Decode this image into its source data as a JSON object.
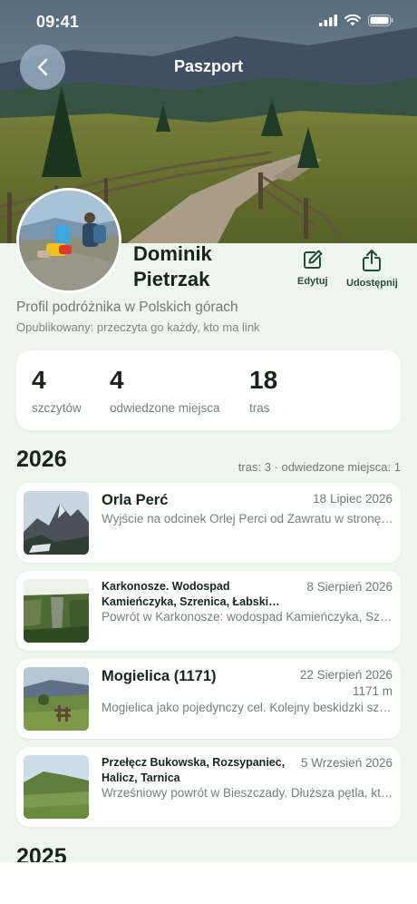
{
  "status_bar": {
    "time": "09:41"
  },
  "header": {
    "title": "Paszport"
  },
  "profile": {
    "first_name": "Dominik",
    "last_name": "Pietrzak",
    "subtitle": "Profil podróżnika w Polskich górach",
    "published": "Opublikowany: przeczyta go każdy, kto ma link"
  },
  "actions": {
    "edit_label": "Edytuj",
    "share_label": "Udostępnij"
  },
  "stats": [
    {
      "value": "4",
      "label": "szczytów"
    },
    {
      "value": "4",
      "label": "odwiedzone miejsca"
    },
    {
      "value": "18",
      "label": "tras"
    }
  ],
  "years": [
    {
      "year": "2026",
      "summary": "tras: 3 · odwiedzone miejsca: 1",
      "trips": [
        {
          "title": "Orla Perć",
          "date": "18 Lipiec 2026",
          "elevation": "",
          "description": "Wyjście na odcinek Orlej Perci od Zawratu w stronę Koziego Wierchu."
        },
        {
          "title": "Karkonosze. Wodospad Kamieńczyka, Szrenica, Łabski Szczyt",
          "date": "8 Sierpień 2026",
          "elevation": "",
          "description": "Powrót w Karkonosze: wodospad Kamieńczyka, Szrenica i Łabski Szczyt."
        },
        {
          "title": "Mogielica (1171)",
          "date": "22 Sierpień 2026",
          "elevation": "1171 m",
          "description": "Mogielica jako pojedynczy cel. Kolejny beskidzki szczyt w kolekcji."
        },
        {
          "title": "Przełęcz Bukowska, Rozsypaniec, Halicz, Tarnica",
          "date": "5 Wrzesień 2026",
          "elevation": "",
          "description": "Wrześniowy powrót w Bieszczady. Dłuższa pętla, która prowadzi granią."
        }
      ]
    },
    {
      "year": "2025"
    }
  ],
  "colors": {
    "accent": "#1f4d36",
    "background": "#eef4ee"
  }
}
